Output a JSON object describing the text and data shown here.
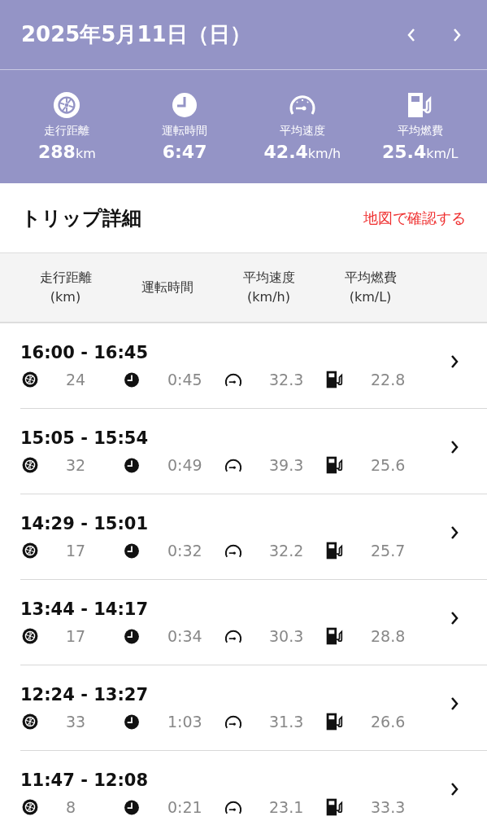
{
  "header": {
    "date": "2025年5月11日（日）"
  },
  "summary": [
    {
      "kind": "distance",
      "label": "走行距離",
      "value": "288",
      "unit": "km"
    },
    {
      "kind": "time",
      "label": "運転時間",
      "value": "6:47"
    },
    {
      "kind": "speed",
      "label": "平均速度",
      "value": "42.4",
      "unit": "km/h"
    },
    {
      "kind": "fuel",
      "label": "平均燃費",
      "value": "25.4",
      "unit": "km/L"
    }
  ],
  "section": {
    "title": "トリップ詳細",
    "link": "地図で確認する"
  },
  "table": {
    "columns": [
      [
        "走行距離",
        "(km)"
      ],
      [
        "運転時間"
      ],
      [
        "平均速度",
        "(km/h)"
      ],
      [
        "平均燃費",
        "(km/L)"
      ]
    ],
    "rows": [
      {
        "time": "16:00 - 16:45",
        "distance": "24",
        "duration": "0:45",
        "speed": "32.3",
        "economy": "22.8"
      },
      {
        "time": "15:05 - 15:54",
        "distance": "32",
        "duration": "0:49",
        "speed": "39.3",
        "economy": "25.6"
      },
      {
        "time": "14:29 - 15:01",
        "distance": "17",
        "duration": "0:32",
        "speed": "32.2",
        "economy": "25.7"
      },
      {
        "time": "13:44 - 14:17",
        "distance": "17",
        "duration": "0:34",
        "speed": "30.3",
        "economy": "28.8"
      },
      {
        "time": "12:24 - 13:27",
        "distance": "33",
        "duration": "1:03",
        "speed": "31.3",
        "economy": "26.6"
      },
      {
        "time": "11:47 - 12:08",
        "distance": "8",
        "duration": "0:21",
        "speed": "23.1",
        "economy": "33.3"
      }
    ]
  }
}
